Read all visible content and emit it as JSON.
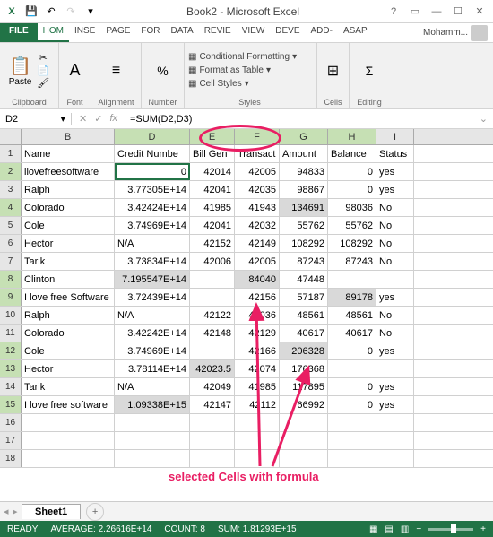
{
  "title": "Book2 - Microsoft Excel",
  "qat": {
    "excel": "X",
    "save": "💾",
    "undo": "↶",
    "redo": "↷"
  },
  "wincontrols": {
    "help": "?",
    "ribbonopts": "▭",
    "min": "—",
    "max": "☐",
    "close": "✕"
  },
  "tabs": {
    "file": "FILE",
    "home": "HOM",
    "insert": "INSE",
    "page": "PAGE",
    "formulas": "FOR",
    "data": "DATA",
    "review": "REVIE",
    "view": "VIEW",
    "developer": "DEVE",
    "addins": "ADD-",
    "asap": "ASAP",
    "user": "Mohamm..."
  },
  "ribbon": {
    "clipboard": {
      "label": "Clipboard",
      "paste": "Paste"
    },
    "font": {
      "label": "Font"
    },
    "alignment": {
      "label": "Alignment"
    },
    "number": {
      "label": "Number"
    },
    "styles": {
      "label": "Styles",
      "cf": "Conditional Formatting",
      "fat": "Format as Table",
      "cs": "Cell Styles"
    },
    "cells": {
      "label": "Cells"
    },
    "editing": {
      "label": "Editing"
    }
  },
  "namebox": "D2",
  "formula": "=SUM(D2,D3)",
  "fx_label": "fx",
  "cols": [
    "B",
    "D",
    "E",
    "F",
    "G",
    "H",
    "I"
  ],
  "headers": {
    "b": "Name",
    "d": "Credit Numbe",
    "e": "Bill Gen",
    "f": "Transact",
    "g": "Amount",
    "h": "Balance",
    "i": "Status"
  },
  "rows": [
    {
      "n": "2",
      "b": "ilovefreesoftware",
      "d": "0",
      "e": "42014",
      "f": "42005",
      "g": "94833",
      "h": "0",
      "i": "yes"
    },
    {
      "n": "3",
      "b": "Ralph",
      "d": "3.77305E+14",
      "e": "42041",
      "f": "42035",
      "g": "98867",
      "h": "0",
      "i": "yes"
    },
    {
      "n": "4",
      "b": "Colorado",
      "d": "3.42424E+14",
      "e": "41985",
      "f": "41943",
      "g": "134691",
      "h": "98036",
      "i": "No"
    },
    {
      "n": "5",
      "b": "Cole",
      "d": "3.74969E+14",
      "e": "42041",
      "f": "42032",
      "g": "55762",
      "h": "55762",
      "i": "No"
    },
    {
      "n": "6",
      "b": "Hector",
      "d": "N/A",
      "e": "42152",
      "f": "42149",
      "g": "108292",
      "h": "108292",
      "i": "No"
    },
    {
      "n": "7",
      "b": "Tarik",
      "d": "3.73834E+14",
      "e": "42006",
      "f": "42005",
      "g": "87243",
      "h": "87243",
      "i": "No"
    },
    {
      "n": "8",
      "b": "Clinton",
      "d": "7.195547E+14",
      "e": "",
      "f": "84040",
      "g": "47448",
      "h": "",
      "i": ""
    },
    {
      "n": "9",
      "b": "I love free Software",
      "d": "3.72439E+14",
      "e": "",
      "f": "42156",
      "g": "57187",
      "h": "89178",
      "i": "yes"
    },
    {
      "n": "10",
      "b": "Ralph",
      "d": "N/A",
      "e": "42122",
      "f": "42036",
      "g": "48561",
      "h": "48561",
      "i": "No"
    },
    {
      "n": "11",
      "b": "Colorado",
      "d": "3.42242E+14",
      "e": "42148",
      "f": "42129",
      "g": "40617",
      "h": "40617",
      "i": "No"
    },
    {
      "n": "12",
      "b": "Cole",
      "d": "3.74969E+14",
      "e": "",
      "f": "42166",
      "g": "206328",
      "h": "0",
      "i": "yes"
    },
    {
      "n": "13",
      "b": "Hector",
      "d": "3.78114E+14",
      "e": "42023.5",
      "f": "42074",
      "g": "176368",
      "h": "",
      "i": ""
    },
    {
      "n": "14",
      "b": "Tarik",
      "d": "N/A",
      "e": "42049",
      "f": "41985",
      "g": "117895",
      "h": "0",
      "i": "yes"
    },
    {
      "n": "15",
      "b": "I love free software",
      "d": "1.09338E+15",
      "e": "42147",
      "f": "42112",
      "g": "66992",
      "h": "0",
      "i": "yes"
    }
  ],
  "empty_rows": [
    "16",
    "17",
    "18"
  ],
  "sheet": {
    "name": "Sheet1",
    "add": "+"
  },
  "status": {
    "ready": "READY",
    "avg": "AVERAGE: 2.26616E+14",
    "count": "COUNT: 8",
    "sum": "SUM: 1.81293E+15"
  },
  "annotation": "selected Cells with formula",
  "selected_cells": [
    "D2",
    "D8",
    "F8",
    "G4",
    "H9",
    "G12",
    "E13",
    "D15"
  ]
}
